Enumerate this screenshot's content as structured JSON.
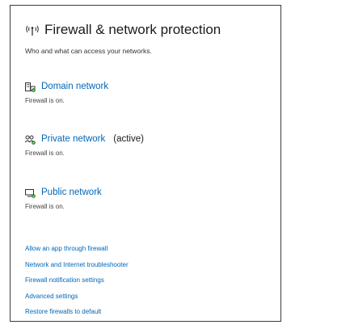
{
  "header": {
    "icon": "wifi-signal-icon",
    "title": "Firewall & network protection",
    "subtitle": "Who and what can access your networks."
  },
  "networks": [
    {
      "icon": "domain-network-icon",
      "name": "Domain network",
      "active_label": "",
      "status": "Firewall is on."
    },
    {
      "icon": "private-network-icon",
      "name": "Private network",
      "active_label": "(active)",
      "status": "Firewall is on."
    },
    {
      "icon": "public-network-icon",
      "name": "Public network",
      "active_label": "",
      "status": "Firewall is on."
    }
  ],
  "links": [
    "Allow an app through firewall",
    "Network and Internet troubleshooter",
    "Firewall notification settings",
    "Advanced settings",
    "Restore firewalls to default"
  ],
  "colors": {
    "link": "#0067b8",
    "text": "#1b1b1b",
    "status_ok": "#107c10"
  }
}
